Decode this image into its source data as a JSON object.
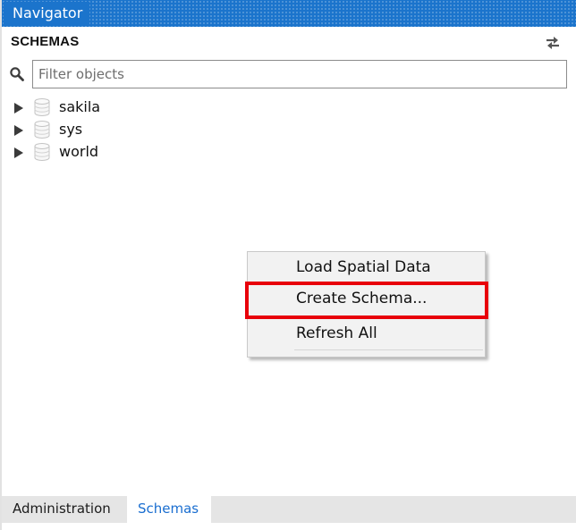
{
  "titlebar": {
    "title": "Navigator"
  },
  "section": {
    "heading": "SCHEMAS",
    "refresh_icon": "refresh-icon"
  },
  "filter": {
    "placeholder": "Filter objects",
    "value": "",
    "icon": "search-icon"
  },
  "tree": {
    "items": [
      {
        "label": "sakila",
        "icon": "database-icon",
        "expander": "expand-arrow-icon"
      },
      {
        "label": "sys",
        "icon": "database-icon",
        "expander": "expand-arrow-icon"
      },
      {
        "label": "world",
        "icon": "database-icon",
        "expander": "expand-arrow-icon"
      }
    ]
  },
  "context_menu": {
    "items": [
      {
        "label": "Load Spatial Data"
      },
      {
        "label": "Create Schema..."
      },
      {
        "label": "Refresh All"
      }
    ],
    "highlighted_item": "Create Schema...",
    "highlight_color": "#e8000a"
  },
  "tabs": [
    {
      "label": "Administration",
      "active": false
    },
    {
      "label": "Schemas",
      "active": true
    }
  ],
  "colors": {
    "titlebar": "#1b74cc",
    "active_tab_text": "#1a6ed0",
    "menu_background": "#f2f2f2"
  }
}
